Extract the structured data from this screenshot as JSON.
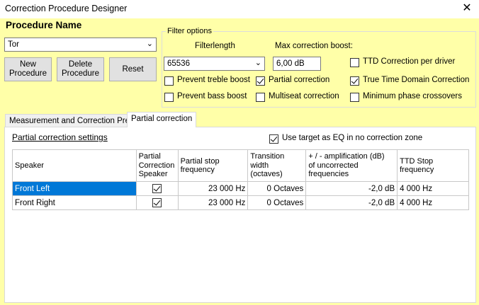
{
  "window": {
    "title": "Correction Procedure Designer",
    "close_glyph": "✕"
  },
  "procedure": {
    "label": "Procedure Name",
    "selected": "Tor",
    "new_label_line1": "New",
    "new_label_line2": "Procedure",
    "delete_label_line1": "Delete",
    "delete_label_line2": "Procedure",
    "reset_label": "Reset"
  },
  "filter_options": {
    "title": "Filter options",
    "filterlength_label": "Filterlength",
    "filterlength_value": "65536",
    "max_boost_label": "Max correction boost:",
    "max_boost_value": "6,00 dB",
    "checkboxes": {
      "prevent_treble": {
        "label": "Prevent treble boost",
        "checked": false
      },
      "prevent_bass": {
        "label": "Prevent bass boost",
        "checked": false
      },
      "partial_correction": {
        "label": "Partial correction",
        "checked": true
      },
      "multiseat": {
        "label": "Multiseat correction",
        "checked": false
      },
      "ttd_per_driver": {
        "label": "TTD Correction per driver",
        "checked": false
      },
      "true_time_domain": {
        "label": "True Time Domain Correction",
        "checked": true
      },
      "min_phase": {
        "label": "Minimum phase crossovers",
        "checked": false
      }
    }
  },
  "tabs": [
    {
      "label": "Measurement and Correction Prep",
      "active": false
    },
    {
      "label": "Partial correction",
      "active": true
    }
  ],
  "partial": {
    "settings_label": "Partial correction settings",
    "use_target_label": "Use target as EQ in no correction zone",
    "use_target_checked": true,
    "columns": {
      "speaker": "Speaker",
      "partial_speaker_l1": "Partial",
      "partial_speaker_l2": "Correction",
      "partial_speaker_l3": "Speaker",
      "stop_freq_l1": "Partial stop",
      "stop_freq_l2": "frequency",
      "transition_l1": "Transition",
      "transition_l2": "width",
      "transition_l3": "(octaves)",
      "amp_l1": "+ / - amplification (dB)",
      "amp_l2": "of uncorrected",
      "amp_l3": "frequencies",
      "ttd_l1": "TTD Stop",
      "ttd_l2": "frequency"
    },
    "rows": [
      {
        "speaker": "Front Left",
        "checked": true,
        "stop": "23 000 Hz",
        "transition": "0 Octaves",
        "amp": "-2,0 dB",
        "ttd": "4 000 Hz"
      },
      {
        "speaker": "Front Right",
        "checked": true,
        "stop": "23 000 Hz",
        "transition": "0 Octaves",
        "amp": "-2,0 dB",
        "ttd": "4 000 Hz"
      }
    ]
  }
}
